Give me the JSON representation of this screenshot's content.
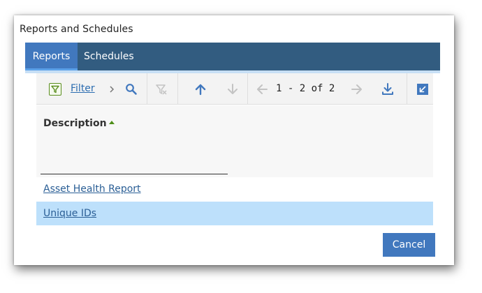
{
  "dialog": {
    "title": "Reports and Schedules"
  },
  "tabs": [
    {
      "label": "Reports",
      "active": true
    },
    {
      "label": "Schedules",
      "active": false
    }
  ],
  "toolbar": {
    "filter_label": "Filter",
    "pager": "1 - 2 of 2",
    "icons": [
      "filter-icon",
      "chevron-right-icon",
      "search-icon",
      "clear-filter-icon",
      "arrow-up-icon",
      "arrow-down-icon",
      "arrow-left-icon",
      "arrow-right-icon",
      "download-icon",
      "maximize-icon"
    ]
  },
  "table": {
    "column_header": "Description",
    "sort": "ascending",
    "rows": [
      {
        "description": "Asset Health Report",
        "selected": false
      },
      {
        "description": "Unique IDs",
        "selected": true
      }
    ]
  },
  "footer": {
    "cancel_label": "Cancel"
  },
  "colors": {
    "tab_bar": "#325c80",
    "active_tab": "#4178be",
    "selected_row": "#bde0fb",
    "link": "#2b5f96",
    "filter_icon": "#5a8d1e",
    "toolbar_icon": "#4178be"
  }
}
